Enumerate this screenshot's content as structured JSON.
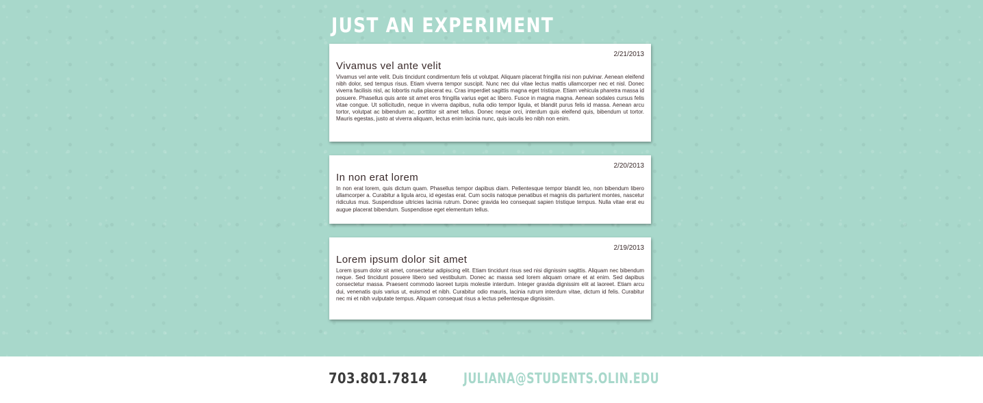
{
  "header": {
    "title": "JUST AN EXPERIMENT"
  },
  "posts": [
    {
      "date": "2/21/2013",
      "title": "Vivamus vel ante velit",
      "body": "Vivamus vel ante velit. Duis tincidunt condimentum felis ut volutpat. Aliquam placerat fringilla nisi non pulvinar. Aenean eleifend nibh dolor, sed tempus risus. Etiam viverra tempor suscipit. Nunc nec dui vitae lectus mattis ullamcorper nec et nisl. Donec viverra facilisis nisl, ac lobortis nulla placerat eu. Cras imperdiet sagittis magna eget tristique. Etiam vehicula pharetra massa id posuere. Phasellus quis ante sit amet eros fringilla varius eget ac libero. Fusce in magna magna. Aenean sodales cursus felis vitae congue. Ut sollicitudin, neque in viverra dapibus, nulla odio tempor ligula, et blandit purus felis id massa. Aenean arcu tortor, volutpat ac bibendum ac, porttitor sit amet tellus. Donec neque orci, interdum quis eleifend quis, bibendum ut tortor. Mauris egestas, justo at viverra aliquam, lectus enim lacinia nunc, quis iaculis leo nibh non enim."
    },
    {
      "date": "2/20/2013",
      "title": "In non erat lorem",
      "body": "In non erat lorem, quis dictum quam. Phasellus tempor dapibus diam. Pellentesque tempor blandit leo, non bibendum libero ullamcorper a. Curabitur a ligula arcu, id egestas erat. Cum sociis natoque penatibus et magnis dis parturient montes, nascetur ridiculus mus. Suspendisse ultricies lacinia rutrum. Donec gravida leo consequat sapien tristique tempus. Nulla vitae erat eu augue placerat bibendum. Suspendisse eget elementum tellus."
    },
    {
      "date": "2/19/2013",
      "title": "Lorem ipsum dolor sit amet",
      "body": "Lorem ipsum dolor sit amet, consectetur adipiscing elit. Etiam tincidunt risus sed nisi dignissim sagittis. Aliquam nec bibendum neque. Sed tincidunt posuere libero sed vestibulum. Donec ac massa sed lorem aliquam ornare et at enim. Sed dapibus consectetur massa. Praesent commodo laoreet turpis molestie interdum. Integer gravida dignissim elit at laoreet. Etiam arcu dui, venenatis quis varius ut, euismod et nibh. Curabitur odio mauris, lacinia rutrum interdum vitae, dictum id felis. Curabitur nec mi et nibh vulputate tempus. Aliquam consequat risus a lectus pellentesque dignissim."
    }
  ],
  "footer": {
    "phone": "703.801.7814",
    "email": "JULIANA@STUDENTS.OLIN.EDU"
  },
  "colors": {
    "background": "#a8d8cb",
    "card": "#ffffff",
    "text": "#3a2a2a",
    "phone": "#3b3b3b",
    "email": "#a8d8cb"
  }
}
